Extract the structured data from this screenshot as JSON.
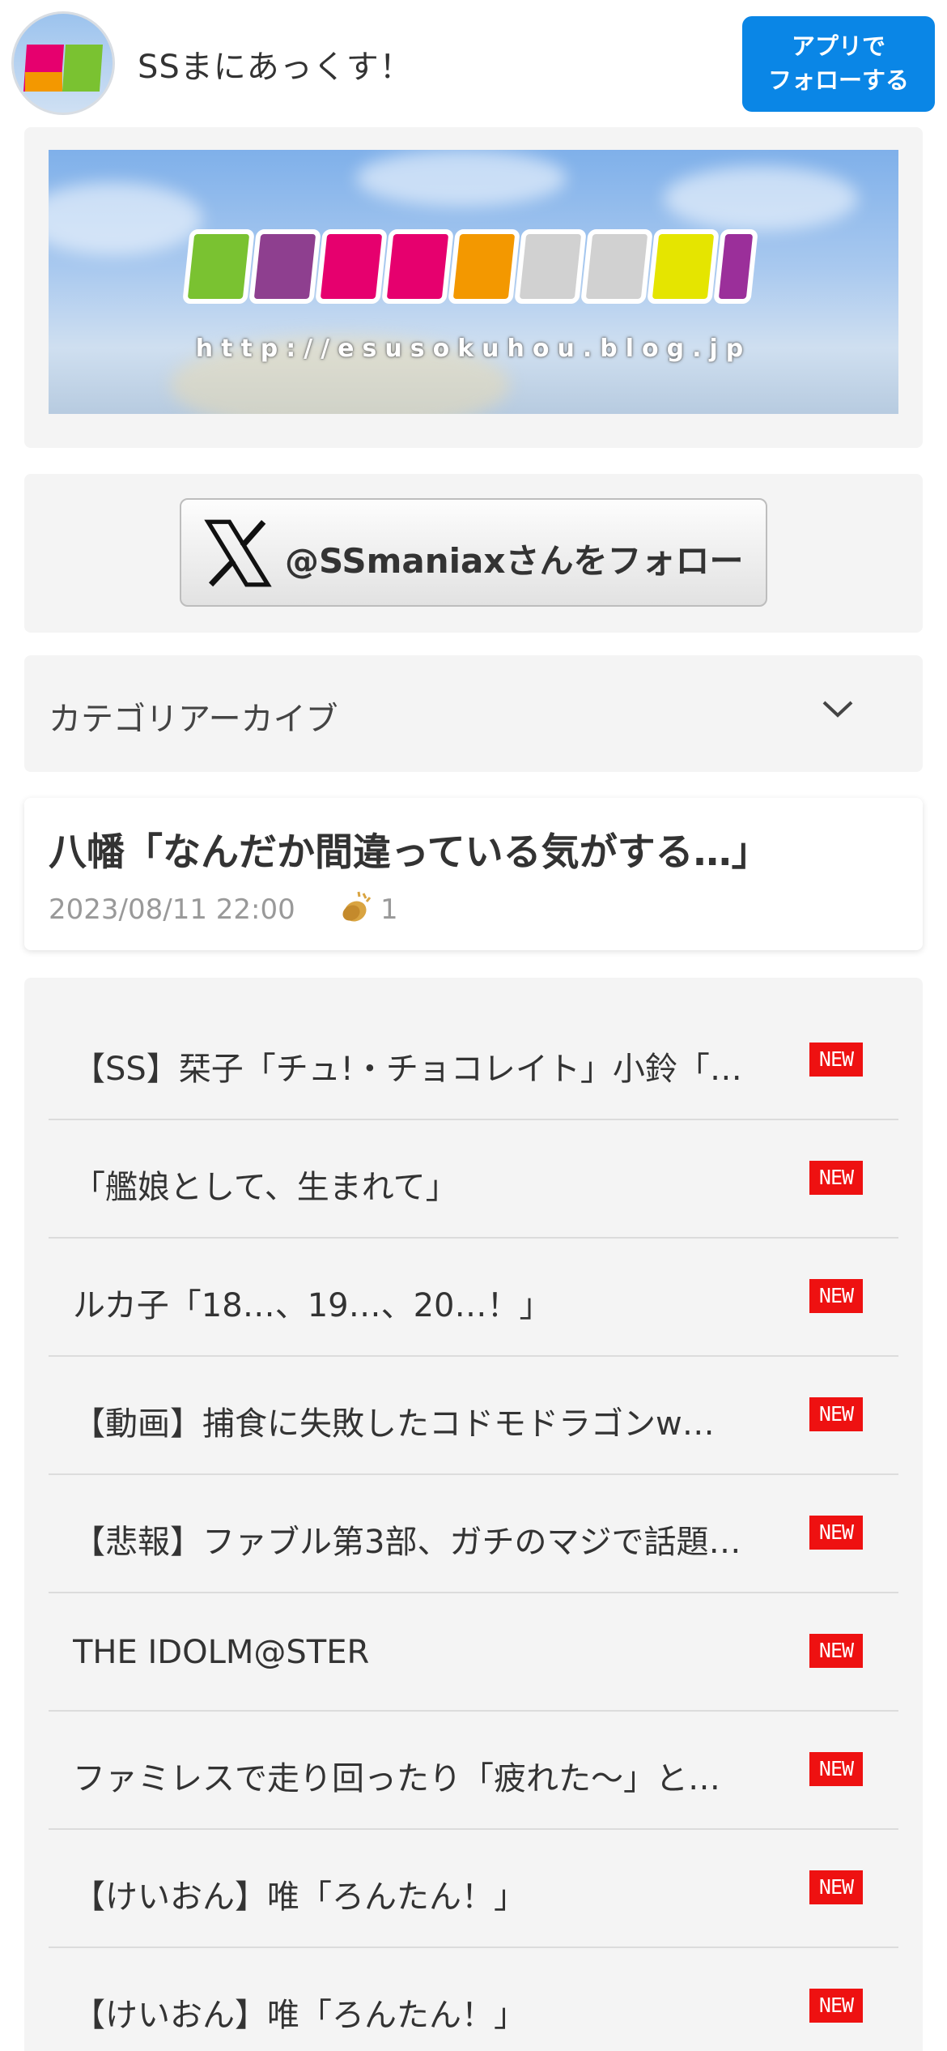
{
  "header": {
    "site_title": "SSまにあっくす！",
    "follow_app_line1": "アプリで",
    "follow_app_line2": "フォローする",
    "accent_color": "#0a86e6"
  },
  "banner": {
    "url_text": "http://esusokuhou.blog.jp",
    "logo_colors": [
      "#7ac231",
      "#8e3f8f",
      "#e6006e",
      "#f39800",
      "#d1d1d1",
      "#9b2f9a",
      "#e5e500"
    ]
  },
  "x_follow": {
    "label": "@SSmaniaxさんをフォロー",
    "icon": "x-logo-icon"
  },
  "category": {
    "label": "カテゴリアーカイブ",
    "icon": "chevron-down-icon"
  },
  "post": {
    "title": "八幡「なんだか間違っている気がする…」",
    "date": "2023/08/11 22:00",
    "clap_icon": "clap-icon",
    "clap_count": "1"
  },
  "list": {
    "badge": "NEW",
    "badge_color": "#ee1111",
    "items": [
      {
        "title": "【SS】栞子「チュ!・チョコレイト」小鈴「…"
      },
      {
        "title": "「艦娘として、生まれて」"
      },
      {
        "title": "ルカ子「18…、19…、20…！」"
      },
      {
        "title": "【動画】捕食に失敗したコドモドラゴンw…"
      },
      {
        "title": "【悲報】ファブル第3部、ガチのマジで話題…"
      },
      {
        "title": "THE IDOLM@STER"
      },
      {
        "title": "ファミレスで走り回ったり「疲れた～」と…"
      },
      {
        "title": "【けいおん】唯「ろんたん！」"
      },
      {
        "title": "【けいおん】唯「ろんたん！」"
      }
    ]
  }
}
